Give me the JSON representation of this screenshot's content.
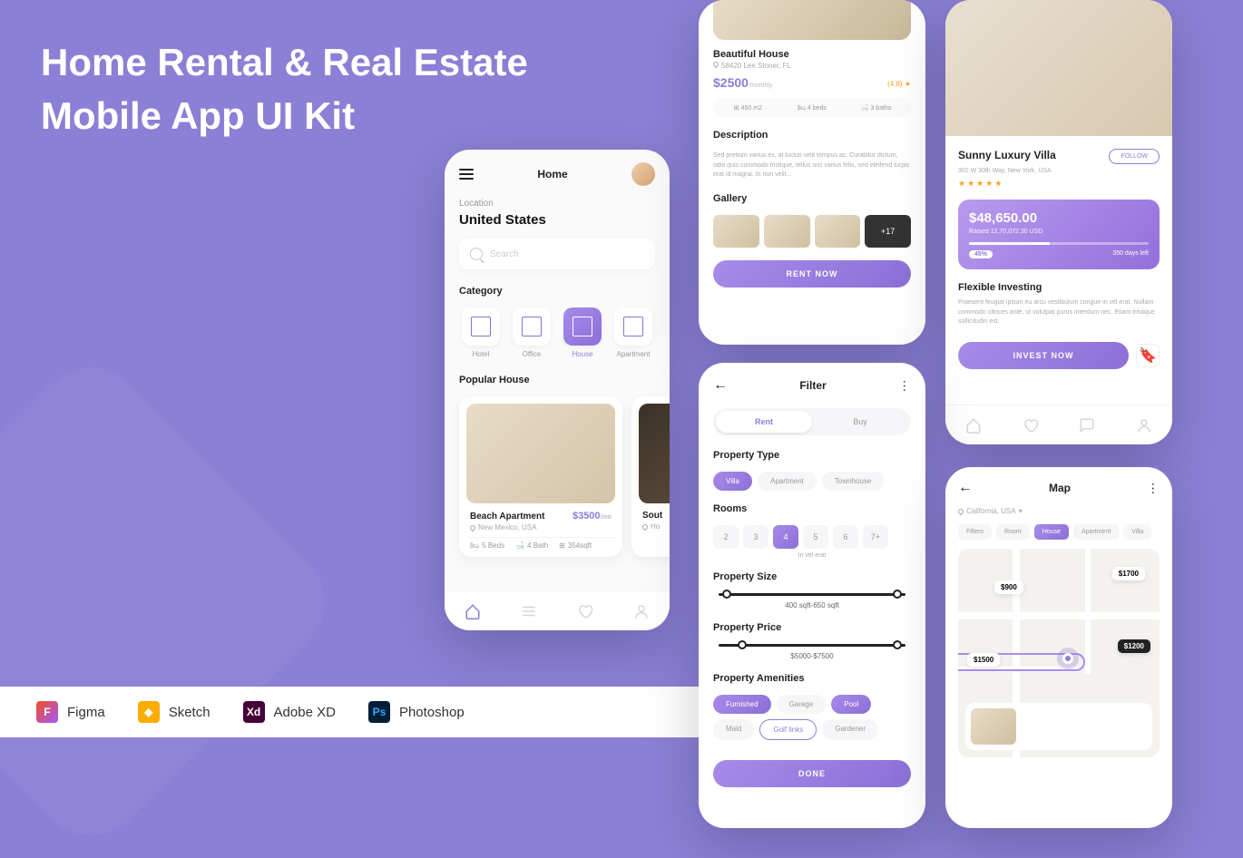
{
  "title_line1": "Home Rental & Real Estate",
  "title_line2": "Mobile App UI Kit",
  "tools": [
    "Figma",
    "Sketch",
    "Adobe XD",
    "Photoshop"
  ],
  "screen1": {
    "header": "Home",
    "location_label": "Location",
    "location_value": "United States",
    "search_placeholder": "Search",
    "category_title": "Category",
    "categories": [
      {
        "label": "Hotel",
        "active": false
      },
      {
        "label": "Office",
        "active": false
      },
      {
        "label": "House",
        "active": true
      },
      {
        "label": "Apartment",
        "active": false
      }
    ],
    "popular_title": "Popular House",
    "card": {
      "name": "Beach Apartment",
      "price": "$3500",
      "price_unit": "/mo",
      "address": "New Mexico, USA",
      "beds": "5 Beds",
      "baths": "4 Bath",
      "sqft": "354sqft"
    },
    "card2_name": "Sout",
    "card2_addr": "Ho"
  },
  "screen2": {
    "name": "Beautiful House",
    "address": "58420 Lee Stoner, FL",
    "price": "$2500",
    "price_unit": "/monthly",
    "rating": "(4.8)",
    "area": "450 m2",
    "beds": "4 beds",
    "baths": "3 baths",
    "desc_title": "Description",
    "desc": "Sed pretium varius ex, at luctus velit tempus ac. Curabitur dictum, odio quis commodo tristique, tellus orci varius felis, sed eleifend turpis erat id magna. In non velit...",
    "gallery_title": "Gallery",
    "gallery_more": "+17",
    "button": "RENT NOW"
  },
  "screen3": {
    "name": "Sunny Luxury Villa",
    "address": "302 W 30th Way, New York, USA",
    "follow": "FOLLOW",
    "amount": "$48,650.00",
    "raised": "Raised 12,70,072.30 USD",
    "pct": "45%",
    "days": "350 days left",
    "section": "Flexible Investing",
    "desc": "Praesent feugiat ipsum eu arcu vestibulum congue in vel erat. Nullam commodo ultrices ante, ut volutpat purus interdum nec. Etiam tristique sollicitudin est.",
    "button": "INVEST NOW"
  },
  "screen4": {
    "title": "Filter",
    "rent": "Rent",
    "buy": "Buy",
    "type_title": "Property Type",
    "types": [
      "Villa",
      "Apartment",
      "Townhouse"
    ],
    "rooms_title": "Rooms",
    "rooms": [
      "2",
      "3",
      "4",
      "5",
      "6",
      "7+"
    ],
    "rooms_sub": "In vel erat",
    "size_title": "Property Size",
    "size_val": "400 sqft-650 sqft",
    "price_title": "Property Price",
    "price_val": "$5000-$7500",
    "amenities_title": "Property Amenities",
    "amenities": [
      {
        "label": "Furnished",
        "type": "active"
      },
      {
        "label": "Garage",
        "type": "normal"
      },
      {
        "label": "Pool",
        "type": "active"
      },
      {
        "label": "Maid",
        "type": "normal"
      },
      {
        "label": "Golf links",
        "type": "outline"
      },
      {
        "label": "Gardener",
        "type": "normal"
      }
    ],
    "done": "DONE"
  },
  "screen5": {
    "title": "Map",
    "location": "California, USA",
    "tabs": [
      "Filters",
      "Room",
      "House",
      "Apartment",
      "Villa"
    ],
    "pins": [
      "$900",
      "$1700",
      "$1500",
      "$1200"
    ]
  }
}
